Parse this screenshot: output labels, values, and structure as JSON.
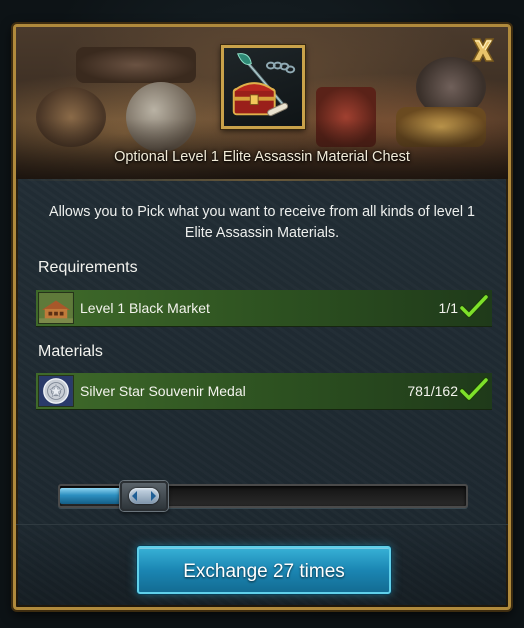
{
  "dialog": {
    "title": "Optional Level 1 Elite Assassin Material Chest",
    "item_icon": "treasure-chest-with-weapons",
    "close_icon": "close-x-icon",
    "description": "Allows you to Pick what you want to receive from all kinds of level 1 Elite Assassin Materials."
  },
  "requirements": {
    "heading": "Requirements",
    "items": [
      {
        "icon": "market-building-icon",
        "label": "Level 1 Black Market",
        "count": "1/1",
        "status": "met"
      }
    ]
  },
  "materials": {
    "heading": "Materials",
    "items": [
      {
        "icon": "silver-medal-icon",
        "label": "Silver Star Souvenir Medal",
        "count": "781/162",
        "status": "met"
      }
    ]
  },
  "slider": {
    "fill_fraction": 0.145,
    "icon": "left-right-arrows-icon"
  },
  "action": {
    "exchange_label": "Exchange 27 times"
  },
  "colors": {
    "frame_gold": "#b08a3c",
    "row_green": "#3f6a2a",
    "check_green": "#7ee02a",
    "button_blue": "#1b86b3",
    "slider_blue": "#2c8fc0"
  }
}
